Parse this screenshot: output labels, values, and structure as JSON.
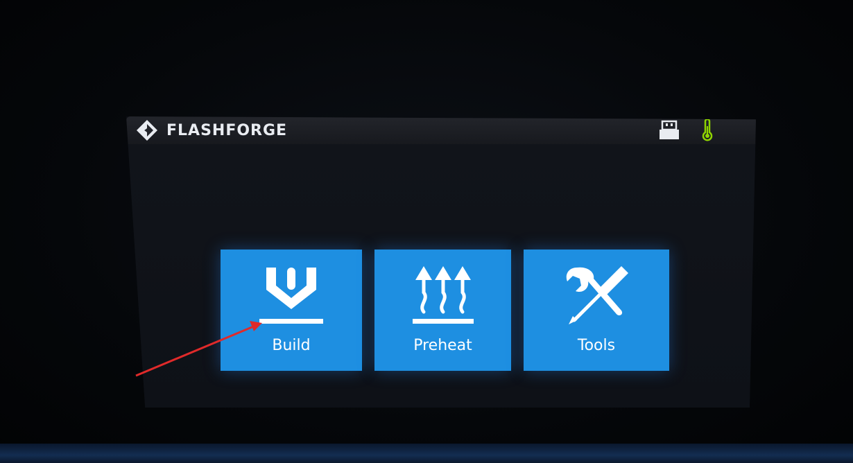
{
  "header": {
    "brand": "FLASHFORGE",
    "status_icons": [
      "usb-icon",
      "thermometer-icon"
    ],
    "colors": {
      "brand_text": "#e9ecf1",
      "thermometer": "#8fd400",
      "usb": "#e9ecf1"
    }
  },
  "menu": {
    "tiles": [
      {
        "label": "Build",
        "icon": "build-icon"
      },
      {
        "label": "Preheat",
        "icon": "preheat-icon"
      },
      {
        "label": "Tools",
        "icon": "tools-icon"
      }
    ],
    "colors": {
      "tile": "#1e8fe1",
      "tile_text": "#ffffff",
      "background": "#0e1117"
    }
  },
  "annotation": {
    "arrow_color": "#e02a2a",
    "points_to": "Build"
  }
}
